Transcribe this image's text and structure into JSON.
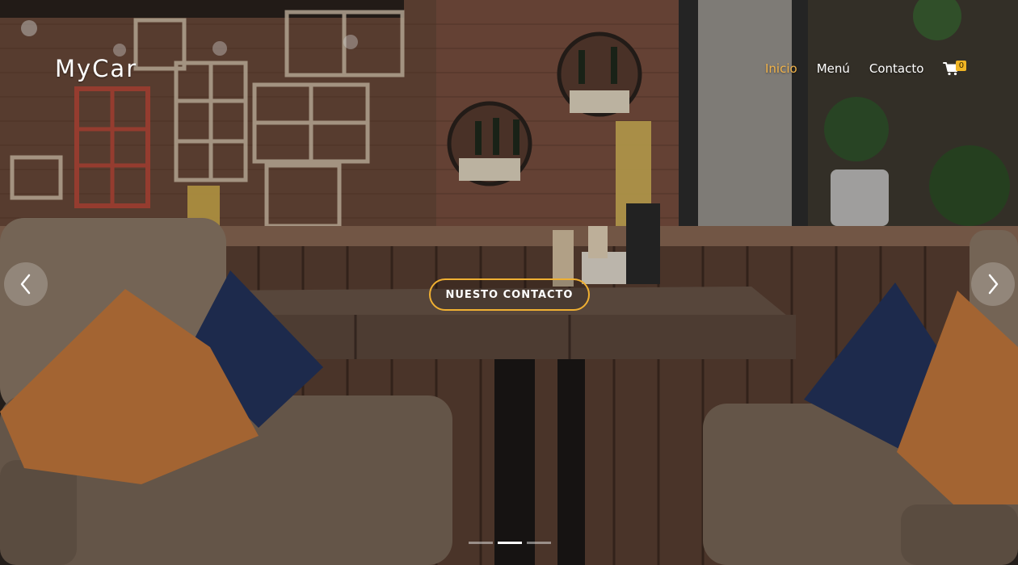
{
  "brand": {
    "name": "MyCar"
  },
  "nav": {
    "items": [
      {
        "label": "Inicio",
        "active": true
      },
      {
        "label": "Menú",
        "active": false
      },
      {
        "label": "Contacto",
        "active": false
      }
    ],
    "cart": {
      "icon": "cart-icon",
      "count": "0"
    }
  },
  "hero": {
    "cta_label": "NUESTO CONTACTO",
    "prev_icon": "chevron-left-icon",
    "next_icon": "chevron-right-icon",
    "slides_total": 3,
    "active_slide": 2
  },
  "colors": {
    "accent": "#f3b44a",
    "badge": "#f0b524",
    "cta_border": "#f0b032"
  }
}
